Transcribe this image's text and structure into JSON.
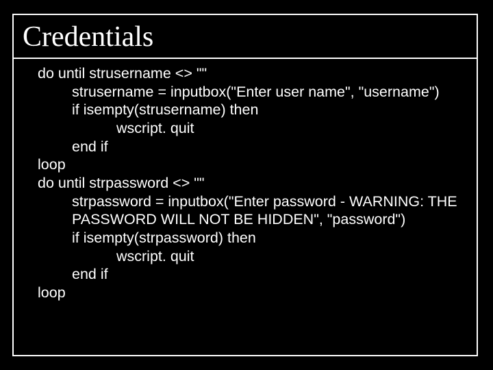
{
  "title": "Credentials",
  "code": {
    "l0": "do until strusername <> \"\"",
    "l1": "strusername = inputbox(\"Enter user name\", \"username\")",
    "l2": "if isempty(strusername) then",
    "l3": "wscript. quit",
    "l4": "end if",
    "l5": "loop",
    "l6": "do until strpassword <> \"\"",
    "l7": "strpassword = inputbox(\"Enter password - WARNING: THE PASSWORD WILL NOT BE HIDDEN\", \"password\")",
    "l8": "if isempty(strpassword) then",
    "l9": "wscript. quit",
    "l10": "end if",
    "l11": "loop"
  }
}
